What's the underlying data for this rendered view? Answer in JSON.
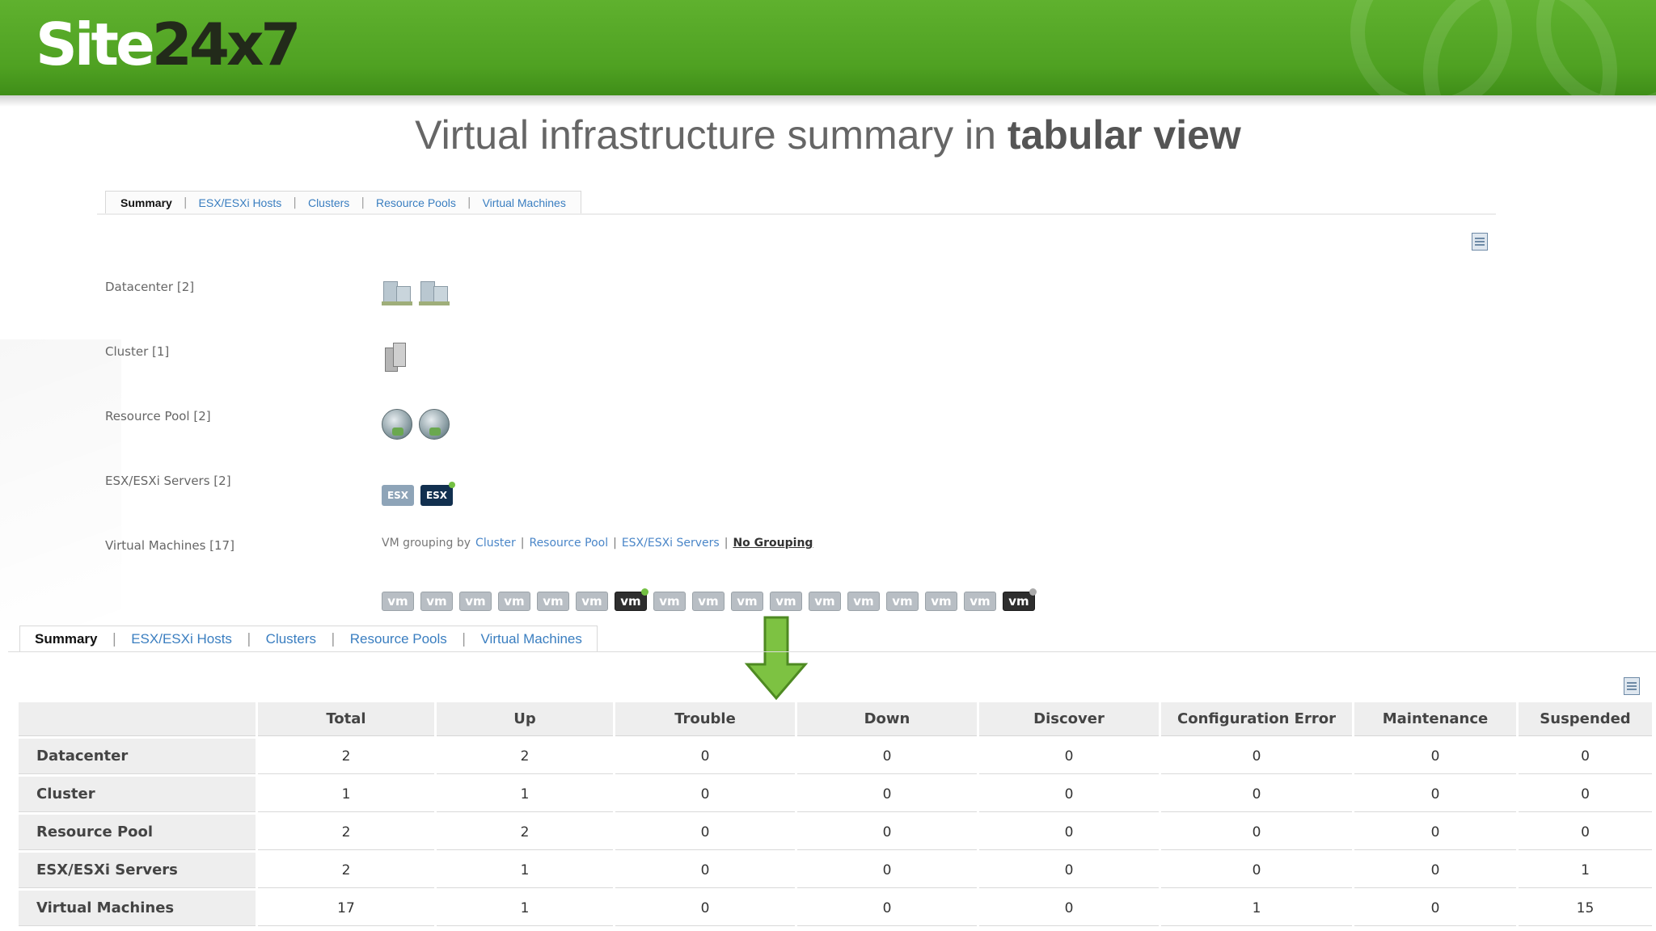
{
  "brand": {
    "logo_part1": "Site",
    "logo_part2": "24x7"
  },
  "slide": {
    "title_prefix": "Virtual infrastructure summary in ",
    "title_bold": "tabular view"
  },
  "tabs": [
    "Summary",
    "ESX/ESXi Hosts",
    "Clusters",
    "Resource Pools",
    "Virtual Machines"
  ],
  "tab_separator": "|",
  "inventory": {
    "datacenter_label": "Datacenter [2]",
    "cluster_label": "Cluster [1]",
    "resource_pool_label": "Resource Pool [2]",
    "esx_label": "ESX/ESXi Servers [2]",
    "vm_label": "Virtual Machines [17]",
    "esx_icon_text": "ESX",
    "vm_icon_text": "vm",
    "vm_grouping": {
      "prefix": "VM grouping by",
      "options": [
        "Cluster",
        "Resource Pool",
        "ESX/ESXi Servers"
      ],
      "separator": "|",
      "selected": "No Grouping"
    }
  },
  "table": {
    "columns": [
      "Total",
      "Up",
      "Trouble",
      "Down",
      "Discover",
      "Configuration Error",
      "Maintenance",
      "Suspended"
    ],
    "rows": [
      {
        "label": "Datacenter",
        "values": [
          "2",
          "2",
          "0",
          "0",
          "0",
          "0",
          "0",
          "0"
        ]
      },
      {
        "label": "Cluster",
        "values": [
          "1",
          "1",
          "0",
          "0",
          "0",
          "0",
          "0",
          "0"
        ]
      },
      {
        "label": "Resource Pool",
        "values": [
          "2",
          "2",
          "0",
          "0",
          "0",
          "0",
          "0",
          "0"
        ]
      },
      {
        "label": "ESX/ESXi Servers",
        "values": [
          "2",
          "1",
          "0",
          "0",
          "0",
          "0",
          "0",
          "1"
        ]
      },
      {
        "label": "Virtual Machines",
        "values": [
          "17",
          "1",
          "0",
          "0",
          "0",
          "1",
          "0",
          "15"
        ]
      }
    ]
  },
  "colors": {
    "brand_green": "#4fa122",
    "arrow_green": "#7dc242",
    "link_blue": "#3a7ec0"
  },
  "icons": {
    "report": "report-document-icon",
    "arrow": "arrow-down-icon"
  }
}
